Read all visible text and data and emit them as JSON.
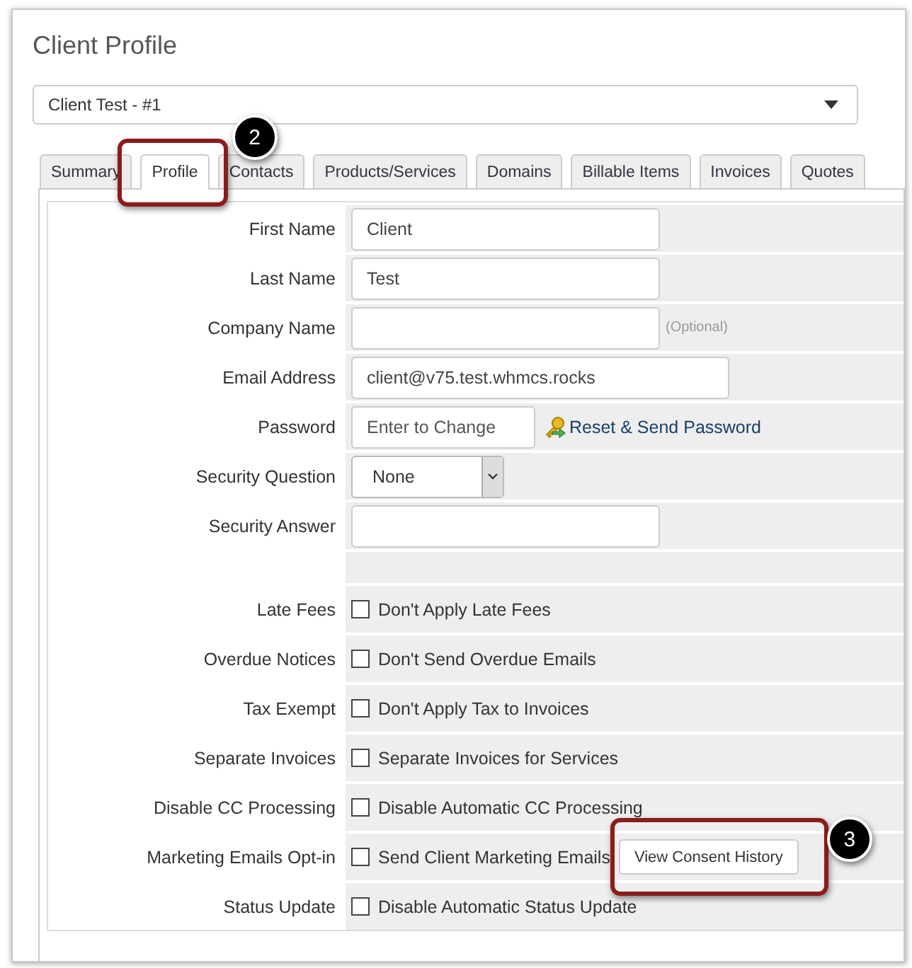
{
  "title": "Client Profile",
  "client_select": {
    "value": "Client Test - #1"
  },
  "tabs": [
    {
      "label": "Summary",
      "selected": false
    },
    {
      "label": "Profile",
      "selected": true,
      "annotation": {
        "number": "2"
      }
    },
    {
      "label": "Contacts",
      "selected": false
    },
    {
      "label": "Products/Services",
      "selected": false
    },
    {
      "label": "Domains",
      "selected": false
    },
    {
      "label": "Billable Items",
      "selected": false
    },
    {
      "label": "Invoices",
      "selected": false
    },
    {
      "label": "Quotes",
      "selected": false
    }
  ],
  "rows": [
    {
      "kind": "text",
      "label": "First Name",
      "value": "Client"
    },
    {
      "kind": "text",
      "label": "Last Name",
      "value": "Test"
    },
    {
      "kind": "text",
      "label": "Company Name",
      "hint": "(Optional)"
    },
    {
      "kind": "text",
      "label": "Email Address",
      "value": "client@v75.test.whmcs.rocks"
    },
    {
      "kind": "password",
      "label": "Password",
      "placeholder": "Enter to Change",
      "link": "Reset & Send Password"
    },
    {
      "kind": "select",
      "label": "Security Question",
      "value": "None"
    },
    {
      "kind": "text",
      "label": "Security Answer"
    },
    {
      "kind": "spacer"
    },
    {
      "kind": "checkbox",
      "label": "Late Fees",
      "text": "Don't Apply Late Fees",
      "checked": false
    },
    {
      "kind": "checkbox",
      "label": "Overdue Notices",
      "text": "Don't Send Overdue Emails",
      "checked": false
    },
    {
      "kind": "checkbox",
      "label": "Tax Exempt",
      "text": "Don't Apply Tax to Invoices",
      "checked": false
    },
    {
      "kind": "checkbox",
      "label": "Separate Invoices",
      "text": "Separate Invoices for Services",
      "checked": false
    },
    {
      "kind": "checkbox",
      "label": "Disable CC Processing",
      "text": "Disable Automatic CC Processing",
      "checked": false
    },
    {
      "kind": "checkbox",
      "label": "Marketing Emails Opt-in",
      "text": "Send Client Marketing Emails",
      "checked": false,
      "button": {
        "label": "View Consent History",
        "annotation": {
          "number": "3"
        }
      }
    },
    {
      "kind": "checkbox",
      "label": "Status Update",
      "text": "Disable Automatic Status Update",
      "checked": false
    }
  ]
}
